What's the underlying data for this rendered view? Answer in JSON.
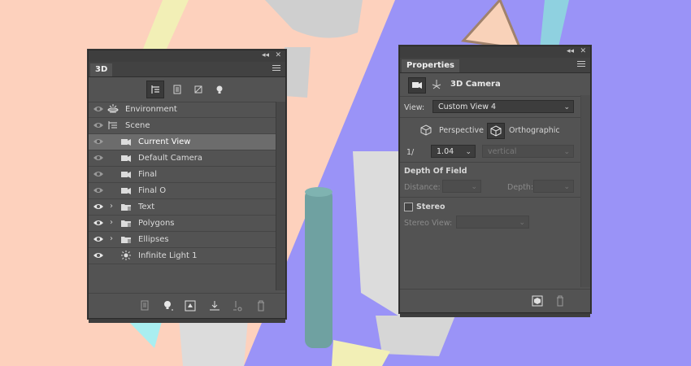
{
  "panel_3d": {
    "tab_label": "3D",
    "collapse_glyph": "◂◂",
    "close_glyph": "✕",
    "filters": [
      "whole-scene-icon",
      "meshes-icon",
      "materials-icon",
      "lights-icon"
    ],
    "layers": [
      {
        "label": "Environment",
        "indent": 0,
        "icon": "environment-icon",
        "expandable": false,
        "visible": true,
        "selected": false
      },
      {
        "label": "Scene",
        "indent": 0,
        "icon": "scene-icon",
        "expandable": false,
        "visible": true,
        "selected": false
      },
      {
        "label": "Current View",
        "indent": 1,
        "icon": "camera-icon",
        "expandable": false,
        "visible": true,
        "selected": true
      },
      {
        "label": "Default Camera",
        "indent": 1,
        "icon": "camera-icon",
        "expandable": false,
        "visible": true,
        "selected": false
      },
      {
        "label": "Final",
        "indent": 1,
        "icon": "camera-icon",
        "expandable": false,
        "visible": true,
        "selected": false
      },
      {
        "label": "Final O",
        "indent": 1,
        "icon": "camera-icon",
        "expandable": false,
        "visible": true,
        "selected": false
      },
      {
        "label": "Text",
        "indent": 1,
        "icon": "mesh-folder-icon",
        "expandable": true,
        "visible": true,
        "selected": false
      },
      {
        "label": "Polygons",
        "indent": 1,
        "icon": "mesh-folder-icon",
        "expandable": true,
        "visible": true,
        "selected": false
      },
      {
        "label": "Ellipses",
        "indent": 1,
        "icon": "mesh-folder-icon",
        "expandable": true,
        "visible": true,
        "selected": false
      },
      {
        "label": "Infinite Light 1",
        "indent": 1,
        "icon": "infinite-light-icon",
        "expandable": false,
        "visible": true,
        "selected": false
      }
    ]
  },
  "properties": {
    "tab_label": "Properties",
    "collapse_glyph": "◂◂",
    "close_glyph": "✕",
    "header_title": "3D Camera",
    "view_label": "View:",
    "view_value": "Custom View 4",
    "perspective_label": "Perspective",
    "orthographic_label": "Orthographic",
    "zoom_prefix": "1/",
    "zoom_value": "1.04",
    "orientation_value": "vertical",
    "dof_title": "Depth Of Field",
    "distance_label": "Distance:",
    "depth_label": "Depth:",
    "stereo_label": "Stereo",
    "stereo_view_label": "Stereo View:"
  },
  "colors": {
    "background_peach": "#fdd1bd",
    "background_violet": "#9a93f7",
    "panel": "#535353",
    "selection": "#6c6c6c"
  }
}
